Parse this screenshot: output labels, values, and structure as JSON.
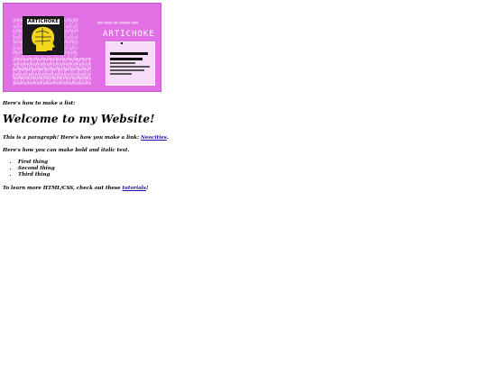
{
  "banner": {
    "logo_title": "ARTICHOKE",
    "heading": "ARTICHOKE"
  },
  "content": {
    "intro": "Here's how to make a list:",
    "title": "Welcome to my Website!",
    "para1_prefix": "This is a paragraph! Here's how you make a link: ",
    "para1_link": "Neocities",
    "para1_suffix": ".",
    "para2_prefix": "Here's how you can make ",
    "para2_bold": "bold",
    "para2_mid": " and ",
    "para2_italic": "italic",
    "para2_suffix": " text.",
    "list_items": [
      "First thing",
      "Second thing",
      "Third thing"
    ],
    "para3_prefix": "To learn more HTML/CSS, check out these ",
    "para3_link": "tutorials",
    "para3_suffix": "!"
  }
}
